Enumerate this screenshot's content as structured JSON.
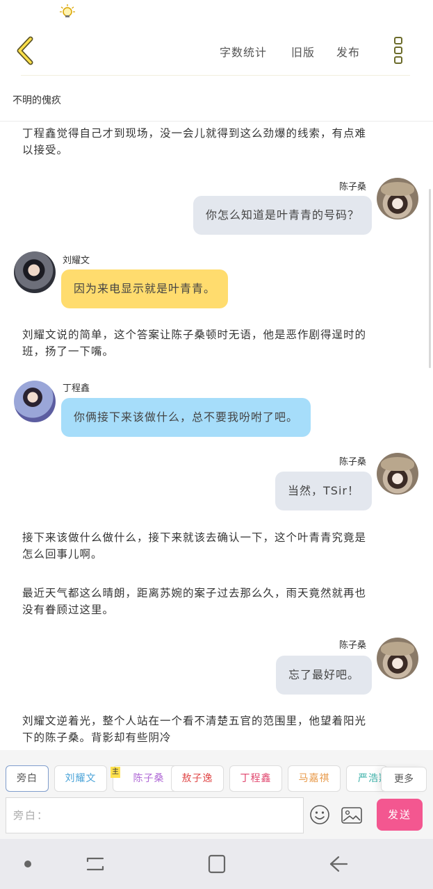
{
  "header": {
    "word_count_label": "字数统计",
    "old_version_label": "旧版",
    "publish_label": "发布",
    "accent_color": "#d4b800"
  },
  "story": {
    "title": "不明的傀疚"
  },
  "messages": [
    {
      "type": "narration",
      "text": "丁程鑫觉得自己才到现场，没一会儿就得到这么劲爆的线索，有点难以接受。"
    },
    {
      "type": "dialogue",
      "side": "right",
      "speaker": "陈子桑",
      "text": "你怎么知道是叶青青的号码？",
      "color": "#e3e7ee"
    },
    {
      "type": "dialogue",
      "side": "left",
      "speaker": "刘耀文",
      "text": "因为来电显示就是叶青青。",
      "color": "#ffdc6e"
    },
    {
      "type": "narration",
      "text": "刘耀文说的简单，这个答案让陈子桑顿时无语，他是恶作剧得逞时的班，扬了一下嘴。"
    },
    {
      "type": "dialogue",
      "side": "left",
      "speaker": "丁程鑫",
      "text": "你俩接下来该做什么，总不要我吩咐了吧。",
      "color": "#a6ddfa"
    },
    {
      "type": "dialogue",
      "side": "right",
      "speaker": "陈子桑",
      "text": "当然，TSir！",
      "color": "#e3e7ee"
    },
    {
      "type": "narration",
      "text": "接下来该做什么做什么，接下来就该去确认一下，这个叶青青究竟是怎么回事儿啊。"
    },
    {
      "type": "narration",
      "text": "最近天气都这么晴朗，距离苏婉的案子过去那么久，雨天竟然就再也没有眷顾过这里。"
    },
    {
      "type": "dialogue",
      "side": "right",
      "speaker": "陈子桑",
      "text": "忘了最好吧。",
      "color": "#e3e7ee"
    },
    {
      "type": "narration",
      "text": "刘耀文逆着光，整个人站在一个看不清楚五官的范围里，他望着阳光下的陈子桑。背影却有些阴冷"
    }
  ],
  "characters": [
    {
      "label": "旁白",
      "color": "#555555",
      "selected": true
    },
    {
      "label": "刘耀文",
      "color": "#4aa3d8"
    },
    {
      "label": "陈子桑",
      "color": "#b06ad6",
      "host": true
    },
    {
      "label": "敖子逸",
      "color": "#e04a4a"
    },
    {
      "label": "丁程鑫",
      "color": "#e0446c"
    },
    {
      "label": "马嘉祺",
      "color": "#e89a4a"
    },
    {
      "label": "严浩翔",
      "color": "#3ab0a8"
    }
  ],
  "host_badge": "主",
  "more_label": "更多",
  "composer": {
    "placeholder": "旁白：",
    "send_label": "发送",
    "send_color": "#f35790"
  }
}
